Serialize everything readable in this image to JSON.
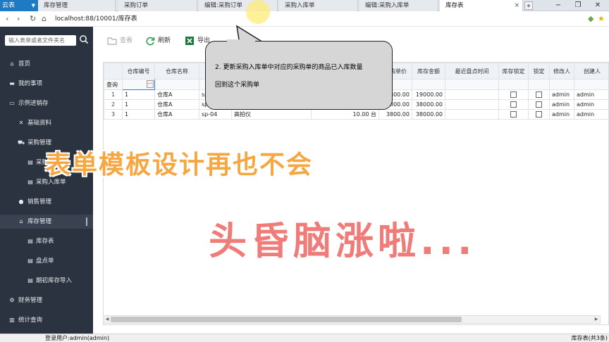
{
  "tabbar": {
    "brand": "云表",
    "tabs": [
      {
        "label": "库存管理"
      },
      {
        "label": "采购订单"
      },
      {
        "label": "编辑:采购订单"
      },
      {
        "label": "采购入库单"
      },
      {
        "label": "编辑:采购入库单"
      },
      {
        "label": "库存表"
      }
    ],
    "close_glyph": "×"
  },
  "address": {
    "url": "localhost:88/10001/库存表"
  },
  "sidebar": {
    "search_placeholder": "输入表单或者文件夹名",
    "items": [
      {
        "label": "首页",
        "icon": "home-icon"
      },
      {
        "label": "我的事项",
        "icon": "folder-icon"
      },
      {
        "label": "示例进销存",
        "icon": "folder-open-icon"
      },
      {
        "label": "基础资料",
        "icon": "tools-icon"
      },
      {
        "label": "采购管理",
        "icon": "cart-icon"
      },
      {
        "label": "采购订单",
        "icon": "doc-icon"
      },
      {
        "label": "采购入库单",
        "icon": "doc-icon"
      },
      {
        "label": "销售管理",
        "icon": "user-icon"
      },
      {
        "label": "库存管理",
        "icon": "house-icon"
      },
      {
        "label": "库存表",
        "icon": "doc-icon"
      },
      {
        "label": "盘点单",
        "icon": "doc-icon"
      },
      {
        "label": "期初库存导入",
        "icon": "doc-icon"
      },
      {
        "label": "财务管理",
        "icon": "gear-icon"
      },
      {
        "label": "统计查询",
        "icon": "chart-icon"
      }
    ]
  },
  "toolbar": {
    "view": "查看",
    "refresh": "刷新",
    "export": "导出"
  },
  "grid": {
    "headers": [
      "",
      "仓库编号",
      "仓库名称",
      "",
      "",
      "",
      "采购单价",
      "库存金额",
      "最近盘点时间",
      "库存锁定",
      "锁定",
      "修改人",
      "创建人"
    ],
    "filter_label": "查询",
    "rows": [
      {
        "n": "1",
        "wh_code": "1",
        "wh_name": "仓库A",
        "code": "sp",
        "name": "",
        "qty": "",
        "price": "3800.00",
        "amount": "19000.00",
        "modifier": "admin",
        "creator": "admin"
      },
      {
        "n": "2",
        "wh_code": "1",
        "wh_name": "仓库A",
        "code": "sp",
        "name": "",
        "qty": "",
        "price": "3800.00",
        "amount": "38000.00",
        "modifier": "admin",
        "creator": "admin"
      },
      {
        "n": "3",
        "wh_code": "1",
        "wh_name": "仓库A",
        "code": "sp-04",
        "name": "高拍仪",
        "qty": "10.00 台",
        "price": "3800.00",
        "amount": "38000.00",
        "modifier": "admin",
        "creator": "admin"
      }
    ]
  },
  "callout": {
    "line1": "2. 更新采购入库单中对应的采购单的商品已入库数量",
    "line2": "回到这个采购单"
  },
  "overlay": {
    "text1": "表单模板设计再也不会",
    "text2": "头昏脑涨啦..."
  },
  "statusbar": {
    "user": "登录用户:admin(admin)",
    "count": "库存表(共3条)"
  },
  "colors": {
    "brand": "#1f7ac4",
    "sidebar": "#2c3340",
    "overlay1": "#f6a742",
    "overlay2": "#ef7c78"
  }
}
